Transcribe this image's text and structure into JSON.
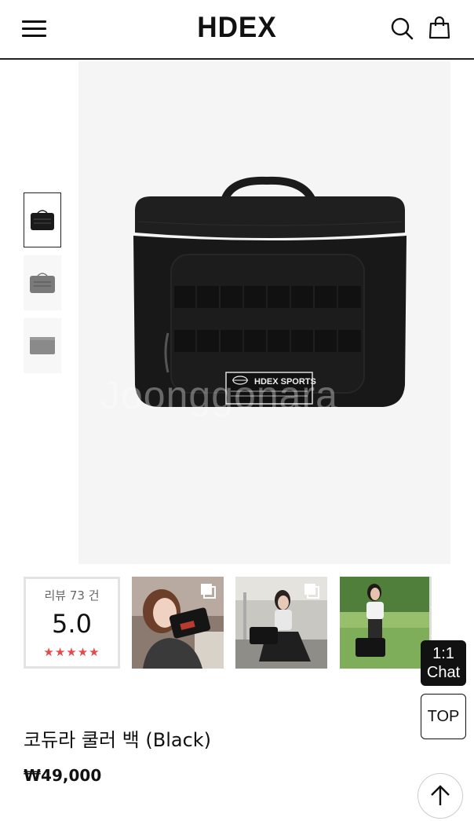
{
  "header": {
    "logo": "HDEX",
    "menu_icon": "hamburger-menu-icon",
    "search_icon": "search-icon",
    "cart_icon": "shopping-bag-icon"
  },
  "gallery": {
    "watermark": "Joonggonara",
    "label_text": "HDEX SPORTS",
    "thumbnails": [
      "black",
      "gray",
      "gray-flat"
    ]
  },
  "reviews": {
    "count_label": "리뷰 73 건",
    "score": "5.0",
    "stars": "★★★★★",
    "rating": 5
  },
  "floating": {
    "chat_line1": "1:1",
    "chat_line2": "Chat",
    "top_label": "TOP"
  },
  "product": {
    "name": "코듀라 쿨러 백 (Black)",
    "price": "₩49,000"
  },
  "colors": {
    "star": "#e24b4b",
    "border": "#222222",
    "image_bg": "#f5f5f5"
  }
}
